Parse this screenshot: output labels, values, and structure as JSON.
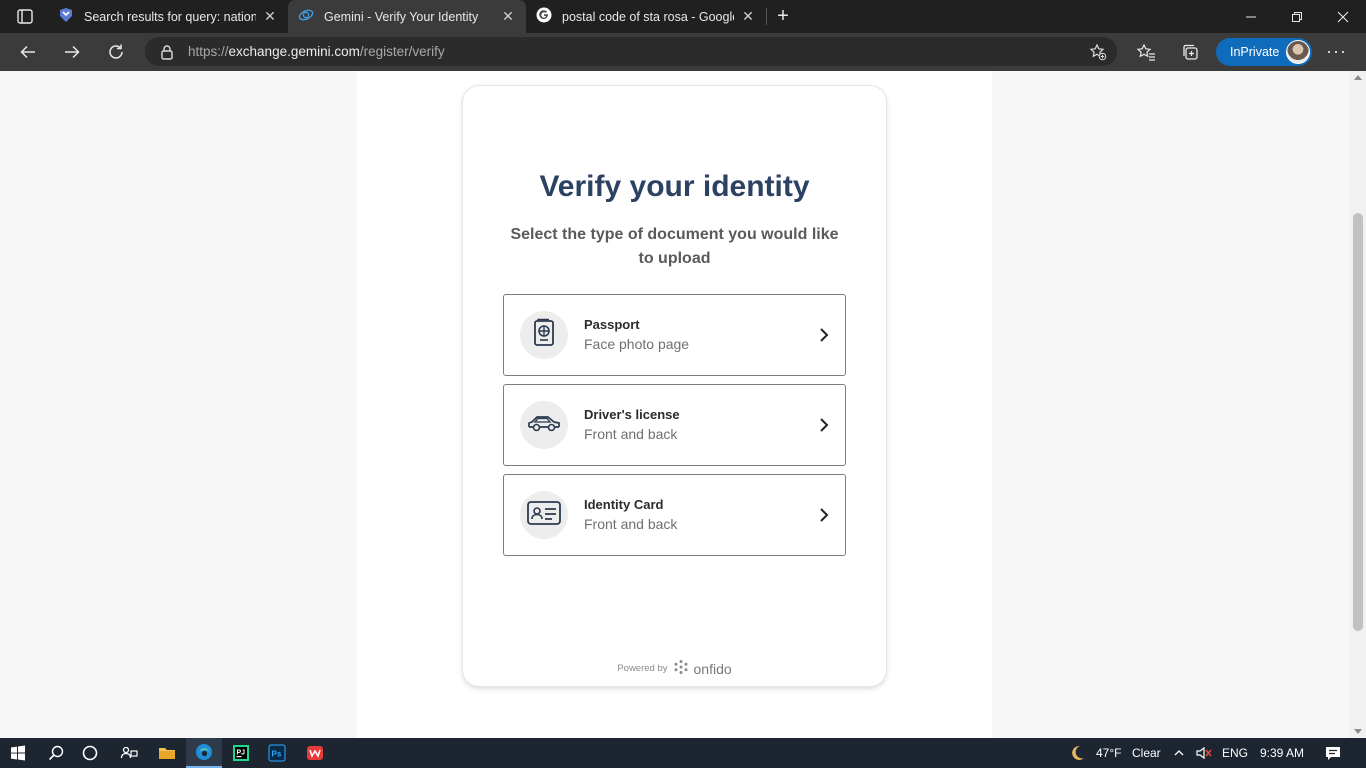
{
  "browser": {
    "tabs": [
      {
        "title": "Search results for query: national",
        "icon": "virustotal-icon",
        "active": false
      },
      {
        "title": "Gemini - Verify Your Identity",
        "icon": "gemini-icon",
        "active": true
      },
      {
        "title": "postal code of sta rosa - Google",
        "icon": "google-icon",
        "active": false
      }
    ],
    "address": {
      "scheme": "https://",
      "host": "exchange.gemini.com",
      "path": "/register/verify"
    },
    "inprivate_label": "InPrivate"
  },
  "page": {
    "title": "Verify your identity",
    "subtitle": "Select the type of document you would like to upload",
    "options": [
      {
        "label": "Passport",
        "hint": "Face photo page",
        "icon": "passport-icon"
      },
      {
        "label": "Driver's license",
        "hint": "Front and back",
        "icon": "car-icon"
      },
      {
        "label": "Identity Card",
        "hint": "Front and back",
        "icon": "id-card-icon"
      }
    ],
    "powered_by": "Powered by",
    "brand": "onfido",
    "title_color": "#2c4262"
  },
  "taskbar": {
    "weather_temp": "47°F",
    "weather_desc": "Clear",
    "language": "ENG",
    "time": "9:39 AM"
  }
}
